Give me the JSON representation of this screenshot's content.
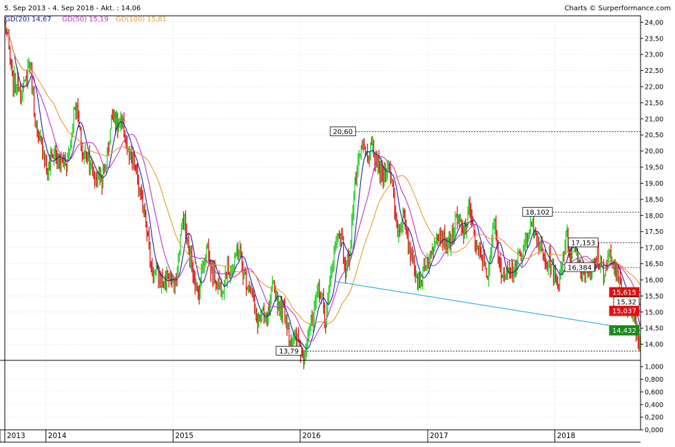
{
  "header": {
    "range_label": "5. Sep 2013 - 4. Sep 2018 - Akt. : 14,06",
    "credit": "Charts © Surperformance.com"
  },
  "legend": [
    {
      "name": "GD(20)",
      "value": "14,67",
      "color": "#1a1aa8"
    },
    {
      "name": "GD(50)",
      "value": "15,19",
      "color": "#c030c0"
    },
    {
      "name": "GD(100)",
      "value": "15,81",
      "color": "#e39a2a"
    }
  ],
  "colors": {
    "up": "#22cc22",
    "down": "#dd1111",
    "trendline": "#33b5dd",
    "badge_red": "#dd1111",
    "badge_green": "#1a8a1a"
  },
  "chart_data": [
    {
      "type": "line",
      "subtype": "ohlc-bars-with-moving-averages",
      "ylim": [
        13.5,
        24.2
      ],
      "y_ticks": [
        {
          "value": 14.0,
          "label": "14,00"
        },
        {
          "value": 14.5,
          "label": "14,50"
        },
        {
          "value": 15.0,
          "label": "15,00"
        },
        {
          "value": 15.5,
          "label": "15,50"
        },
        {
          "value": 16.0,
          "label": "16,00"
        },
        {
          "value": 16.5,
          "label": "16,50"
        },
        {
          "value": 17.0,
          "label": "17,00"
        },
        {
          "value": 17.5,
          "label": "17,50"
        },
        {
          "value": 18.0,
          "label": "18,00"
        },
        {
          "value": 18.5,
          "label": "18,50"
        },
        {
          "value": 19.0,
          "label": "19,00"
        },
        {
          "value": 19.5,
          "label": "19,50"
        },
        {
          "value": 20.0,
          "label": "20,00"
        },
        {
          "value": 20.5,
          "label": "20,50"
        },
        {
          "value": 21.0,
          "label": "21,00"
        },
        {
          "value": 21.5,
          "label": "21,50"
        },
        {
          "value": 22.0,
          "label": "22,00"
        },
        {
          "value": 22.5,
          "label": "22,50"
        },
        {
          "value": 23.0,
          "label": "23,00"
        },
        {
          "value": 23.5,
          "label": "23,50"
        },
        {
          "value": 24.0,
          "label": "24,00"
        }
      ],
      "x_ticks": [
        "2013",
        "2014",
        "2015",
        "2016",
        "2017",
        "2018"
      ],
      "x_tick_dates": [
        "2013-09-05",
        "2014-01-01",
        "2015-01-01",
        "2016-01-01",
        "2017-01-01",
        "2018-01-01"
      ],
      "x_range": [
        "2013-09-05",
        "2018-09-04"
      ],
      "grid": true,
      "price_keypoints": [
        {
          "date": "2013-09-05",
          "close": 23.9
        },
        {
          "date": "2013-09-25",
          "close": 22.4
        },
        {
          "date": "2013-10-20",
          "close": 21.8
        },
        {
          "date": "2013-11-15",
          "close": 22.7
        },
        {
          "date": "2013-12-10",
          "close": 20.3
        },
        {
          "date": "2014-01-05",
          "close": 19.6
        },
        {
          "date": "2014-02-01",
          "close": 19.9
        },
        {
          "date": "2014-03-01",
          "close": 19.5
        },
        {
          "date": "2014-03-25",
          "close": 21.4
        },
        {
          "date": "2014-04-15",
          "close": 20.1
        },
        {
          "date": "2014-05-15",
          "close": 19.4
        },
        {
          "date": "2014-06-10",
          "close": 19.0
        },
        {
          "date": "2014-07-15",
          "close": 21.2
        },
        {
          "date": "2014-08-15",
          "close": 20.4
        },
        {
          "date": "2014-09-15",
          "close": 19.3
        },
        {
          "date": "2014-10-10",
          "close": 18.2
        },
        {
          "date": "2014-10-28",
          "close": 16.6
        },
        {
          "date": "2014-11-18",
          "close": 15.9
        },
        {
          "date": "2014-12-10",
          "close": 16.1
        },
        {
          "date": "2015-01-05",
          "close": 15.8
        },
        {
          "date": "2015-02-01",
          "close": 18.0
        },
        {
          "date": "2015-02-20",
          "close": 16.6
        },
        {
          "date": "2015-03-10",
          "close": 15.6
        },
        {
          "date": "2015-04-10",
          "close": 17.0
        },
        {
          "date": "2015-05-05",
          "close": 15.8
        },
        {
          "date": "2015-06-10",
          "close": 16.2
        },
        {
          "date": "2015-07-05",
          "close": 16.9
        },
        {
          "date": "2015-07-25",
          "close": 16.3
        },
        {
          "date": "2015-08-25",
          "close": 15.0
        },
        {
          "date": "2015-09-20",
          "close": 14.6
        },
        {
          "date": "2015-10-15",
          "close": 15.6
        },
        {
          "date": "2015-11-05",
          "close": 15.3
        },
        {
          "date": "2015-11-28",
          "close": 14.4
        },
        {
          "date": "2015-12-15",
          "close": 14.0
        },
        {
          "date": "2016-01-10",
          "close": 13.85
        },
        {
          "date": "2016-02-05",
          "close": 14.7
        },
        {
          "date": "2016-02-20",
          "close": 15.7
        },
        {
          "date": "2016-03-15",
          "close": 14.9
        },
        {
          "date": "2016-04-01",
          "close": 16.3
        },
        {
          "date": "2016-04-20",
          "close": 17.8
        },
        {
          "date": "2016-05-10",
          "close": 16.1
        },
        {
          "date": "2016-05-25",
          "close": 17.5
        },
        {
          "date": "2016-06-10",
          "close": 19.1
        },
        {
          "date": "2016-06-25",
          "close": 20.3
        },
        {
          "date": "2016-07-10",
          "close": 19.6
        },
        {
          "date": "2016-07-25",
          "close": 20.2
        },
        {
          "date": "2016-08-15",
          "close": 19.2
        },
        {
          "date": "2016-09-05",
          "close": 19.6
        },
        {
          "date": "2016-09-25",
          "close": 18.7
        },
        {
          "date": "2016-10-10",
          "close": 17.4
        },
        {
          "date": "2016-10-25",
          "close": 17.9
        },
        {
          "date": "2016-11-10",
          "close": 16.9
        },
        {
          "date": "2016-11-25",
          "close": 16.3
        },
        {
          "date": "2016-12-10",
          "close": 15.9
        },
        {
          "date": "2016-12-31",
          "close": 16.6
        },
        {
          "date": "2017-01-20",
          "close": 17.2
        },
        {
          "date": "2017-02-10",
          "close": 17.6
        },
        {
          "date": "2017-02-28",
          "close": 16.8
        },
        {
          "date": "2017-03-20",
          "close": 17.9
        },
        {
          "date": "2017-04-10",
          "close": 17.4
        },
        {
          "date": "2017-04-30",
          "close": 18.2
        },
        {
          "date": "2017-05-20",
          "close": 17.1
        },
        {
          "date": "2017-06-05",
          "close": 16.6
        },
        {
          "date": "2017-06-25",
          "close": 16.3
        },
        {
          "date": "2017-07-10",
          "close": 17.6
        },
        {
          "date": "2017-07-25",
          "close": 16.9
        },
        {
          "date": "2017-08-05",
          "close": 15.9
        },
        {
          "date": "2017-08-25",
          "close": 16.6
        },
        {
          "date": "2017-09-15",
          "close": 16.3
        },
        {
          "date": "2017-10-05",
          "close": 17.1
        },
        {
          "date": "2017-10-25",
          "close": 17.8
        },
        {
          "date": "2017-11-10",
          "close": 17.3
        },
        {
          "date": "2017-11-25",
          "close": 16.7
        },
        {
          "date": "2017-12-15",
          "close": 16.6
        },
        {
          "date": "2018-01-05",
          "close": 15.9
        },
        {
          "date": "2018-01-20",
          "close": 16.5
        },
        {
          "date": "2018-02-05",
          "close": 17.3
        },
        {
          "date": "2018-02-25",
          "close": 16.9
        },
        {
          "date": "2018-03-15",
          "close": 16.5
        },
        {
          "date": "2018-04-05",
          "close": 16.2
        },
        {
          "date": "2018-04-25",
          "close": 16.6
        },
        {
          "date": "2018-05-15",
          "close": 16.4
        },
        {
          "date": "2018-06-05",
          "close": 16.6
        },
        {
          "date": "2018-06-20",
          "close": 16.4
        },
        {
          "date": "2018-07-05",
          "close": 16.0
        },
        {
          "date": "2018-07-20",
          "close": 15.5
        },
        {
          "date": "2018-08-05",
          "close": 15.1
        },
        {
          "date": "2018-08-20",
          "close": 14.6
        },
        {
          "date": "2018-09-04",
          "close": 14.06
        }
      ],
      "moving_averages": [
        {
          "name": "GD(20)",
          "window": 20
        },
        {
          "name": "GD(50)",
          "window": 50
        },
        {
          "name": "GD(100)",
          "window": 100
        }
      ],
      "reference_lines": [
        {
          "value": 20.6,
          "label": "20,60",
          "from": "2016-06-08"
        },
        {
          "value": 18.102,
          "label": "18,102",
          "from": "2017-12-25"
        },
        {
          "value": 17.153,
          "label": "17,153",
          "from": "2018-05-05"
        },
        {
          "value": 16.384,
          "label": "16,384",
          "from": "2018-04-25"
        },
        {
          "value": 13.79,
          "label": "13,79",
          "from": "2016-01-05"
        }
      ],
      "badges": [
        {
          "value": 15.615,
          "label": "15,615",
          "style": "red"
        },
        {
          "value": 15.32,
          "label": "15,32",
          "style": "white"
        },
        {
          "value": 15.037,
          "label": "15,037",
          "style": "red"
        },
        {
          "value": 14.432,
          "label": "14,432",
          "style": "green"
        }
      ],
      "trendline": {
        "from_date": "2016-04-10",
        "from_value": 15.95,
        "to_date": "2018-09-04",
        "to_value": 14.43
      }
    },
    {
      "type": "bar",
      "subtype": "volume-panel",
      "ylim": [
        0,
        1.1
      ],
      "y_ticks": [
        {
          "value": 0.0,
          "label": "0,000"
        },
        {
          "value": 0.2,
          "label": "0,200"
        },
        {
          "value": 0.4,
          "label": "0,400"
        },
        {
          "value": 0.6,
          "label": "0,600"
        },
        {
          "value": 0.8,
          "label": "0,800"
        },
        {
          "value": 1.0,
          "label": "1,000"
        }
      ]
    }
  ]
}
